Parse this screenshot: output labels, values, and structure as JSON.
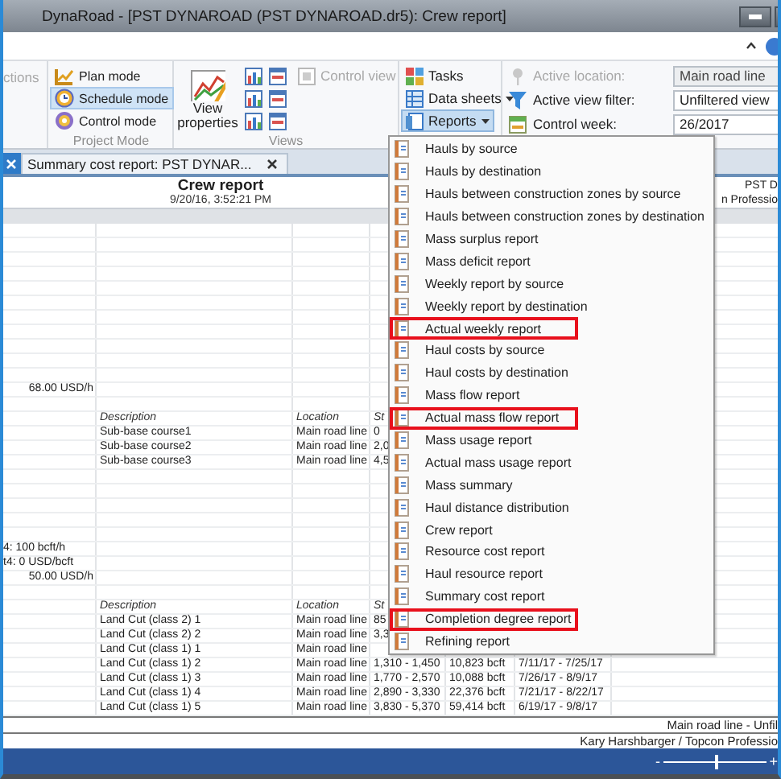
{
  "window": {
    "title": "DynaRoad - [PST DYNAROAD (PST DYNAROAD.dr5): Crew report]"
  },
  "ribbon": {
    "cut_button": {
      "label": "ctions",
      "disabled": true
    },
    "project_mode": {
      "label": "Project Mode",
      "modes": [
        {
          "label": "Plan mode",
          "selected": false
        },
        {
          "label": "Schedule mode",
          "selected": true
        },
        {
          "label": "Control mode",
          "selected": false
        }
      ]
    },
    "views": {
      "label": "Views",
      "view_properties": "View properties",
      "control_view": {
        "label": "Control view",
        "disabled": true
      }
    },
    "commands": [
      {
        "label": "Tasks",
        "dropdown": false,
        "pressed": false
      },
      {
        "label": "Data sheets",
        "dropdown": true,
        "pressed": false
      },
      {
        "label": "Reports",
        "dropdown": true,
        "pressed": true
      }
    ],
    "fields": [
      {
        "label": "Active location:",
        "value": "Main road line",
        "disabled": true
      },
      {
        "label": "Active view filter:",
        "value": "Unfiltered view",
        "disabled": false
      },
      {
        "label": "Control week:",
        "value": "26/2017",
        "disabled": false
      }
    ]
  },
  "document_tabs": [
    {
      "selected": true
    },
    {
      "label": "Summary cost report: PST DYNAR...",
      "selected": false
    }
  ],
  "report": {
    "title": "Crew report",
    "timestamp": "9/20/16, 3:52:21 PM",
    "header_right": [
      "PST D",
      "n Professio"
    ],
    "rows": [
      {
        "kind": "blank"
      },
      {
        "kind": "blank"
      },
      {
        "kind": "blank"
      },
      {
        "kind": "blank"
      },
      {
        "kind": "blank"
      },
      {
        "kind": "blank"
      },
      {
        "kind": "blank"
      },
      {
        "kind": "blank"
      },
      {
        "kind": "blank"
      },
      {
        "kind": "blank"
      },
      {
        "kind": "blank"
      },
      {
        "kind": "line",
        "amount": "68.00 USD/h"
      },
      {
        "kind": "blank"
      },
      {
        "kind": "header",
        "description": "Description",
        "location": "Location",
        "station": "St"
      },
      {
        "kind": "line",
        "description": "Sub-base course1",
        "location": "Main road line",
        "station": "0"
      },
      {
        "kind": "line",
        "description": "Sub-base course2",
        "location": "Main road line",
        "station": "2,0"
      },
      {
        "kind": "line",
        "description": "Sub-base course3",
        "location": "Main road line",
        "station": "4,5"
      },
      {
        "kind": "blank"
      },
      {
        "kind": "blank"
      },
      {
        "kind": "blank"
      },
      {
        "kind": "blank"
      },
      {
        "kind": "blank"
      },
      {
        "kind": "line",
        "note": "4: 100 bcft/h"
      },
      {
        "kind": "line",
        "note": "t4: 0 USD/bcft"
      },
      {
        "kind": "line",
        "amount": "50.00 USD/h"
      },
      {
        "kind": "blank"
      },
      {
        "kind": "header",
        "description": "Description",
        "location": "Location",
        "station": "St"
      },
      {
        "kind": "line",
        "description": "Land Cut (class 2) 1",
        "location": "Main road line",
        "station": "85"
      },
      {
        "kind": "line",
        "description": "Land Cut (class 2) 2",
        "location": "Main road line",
        "station": "3,3"
      },
      {
        "kind": "line",
        "description": "Land Cut (class 1) 1",
        "location": "Main road line"
      },
      {
        "kind": "line",
        "description": "Land Cut (class 1) 2",
        "location": "Main road line",
        "station": "1,310 - 1,450",
        "quantity": "10,823 bcft",
        "dates": "7/11/17 - 7/25/17"
      },
      {
        "kind": "line",
        "description": "Land Cut (class 1) 3",
        "location": "Main road line",
        "station": "1,770 - 2,570",
        "quantity": "10,088 bcft",
        "dates": "7/26/17 - 8/9/17"
      },
      {
        "kind": "line",
        "description": "Land Cut (class 1) 4",
        "location": "Main road line",
        "station": "2,890 - 3,330",
        "quantity": "22,376 bcft",
        "dates": "7/21/17 - 8/22/17"
      },
      {
        "kind": "line",
        "description": "Land Cut (class 1) 5",
        "location": "Main road line",
        "station": "3,830 - 5,370",
        "quantity": "59,414 bcft",
        "dates": "6/19/17 - 9/8/17"
      }
    ]
  },
  "reports_menu": [
    {
      "label": "Hauls by source",
      "highlighted": false
    },
    {
      "label": "Hauls by destination",
      "highlighted": false
    },
    {
      "label": "Hauls between construction zones by source",
      "highlighted": false
    },
    {
      "label": "Hauls between construction zones by destination",
      "highlighted": false
    },
    {
      "label": "Mass surplus report",
      "highlighted": false
    },
    {
      "label": "Mass deficit report",
      "highlighted": false
    },
    {
      "label": "Weekly report by source",
      "highlighted": false
    },
    {
      "label": "Weekly report by destination",
      "highlighted": false
    },
    {
      "label": "Actual weekly report",
      "highlighted": true
    },
    {
      "label": "Haul costs by source",
      "highlighted": false
    },
    {
      "label": "Haul costs by destination",
      "highlighted": false
    },
    {
      "label": "Mass flow report",
      "highlighted": false
    },
    {
      "label": "Actual mass flow report",
      "highlighted": true
    },
    {
      "label": "Mass usage report",
      "highlighted": false
    },
    {
      "label": "Actual mass usage report",
      "highlighted": false
    },
    {
      "label": "Mass summary",
      "highlighted": false
    },
    {
      "label": "Haul distance distribution",
      "highlighted": false
    },
    {
      "label": "Crew report",
      "highlighted": false
    },
    {
      "label": "Resource cost report",
      "highlighted": false
    },
    {
      "label": "Haul resource report",
      "highlighted": false
    },
    {
      "label": "Summary cost report",
      "highlighted": false
    },
    {
      "label": "Completion degree report",
      "highlighted": true
    },
    {
      "label": "Refining report",
      "highlighted": false
    }
  ],
  "status_bar": {
    "location_filter": "Main road line - Unfil",
    "user": "Kary Harshbarger / Topcon Professio",
    "zoom": {
      "minus": "-",
      "plus": "+",
      "level": 0.52
    }
  }
}
